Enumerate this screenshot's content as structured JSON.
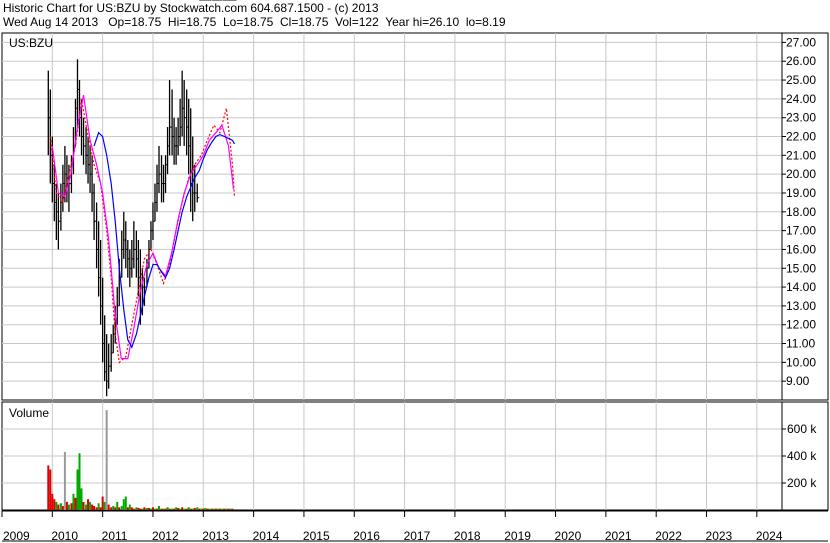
{
  "header": {
    "title": "Historic Chart for US:BZU by Stockwatch.com 604.687.1500 - (c) 2013",
    "quote": "Wed Aug 14 2013   Op=18.75  Hi=18.75  Lo=18.75  Cl=18.75  Vol=122  Year hi=26.10  lo=8.19"
  },
  "colors": {
    "grid": "#c8c8c8",
    "frame": "#000000",
    "price_bar": "#000000",
    "ma_short": "#ff0000",
    "ma_mid": "#ff00ff",
    "ma_long": "#0000ff",
    "volume_up": "#00aa00",
    "volume_down": "#dd0000",
    "volume_spike": "#999999"
  },
  "chart_data": [
    {
      "type": "line",
      "panel": "price",
      "label": "US:BZU",
      "ylim": [
        8,
        27.5
      ],
      "yticks": [
        "9.00",
        "10.00",
        "11.00",
        "12.00",
        "13.00",
        "14.00",
        "15.00",
        "16.00",
        "17.00",
        "18.00",
        "19.00",
        "20.00",
        "21.00",
        "22.00",
        "23.00",
        "24.00",
        "25.00",
        "26.00",
        "27.00"
      ],
      "xlim": [
        2009.0,
        2024.5
      ],
      "xtick_labels": [
        "2009",
        "2010",
        "2011",
        "2012",
        "2013",
        "2014",
        "2015",
        "2016",
        "2017",
        "2018",
        "2019",
        "2020",
        "2021",
        "2022",
        "2023",
        "2024"
      ],
      "grid": true,
      "series": [
        {
          "style": "price-bars",
          "x": [
            2009.92,
            2009.96,
            2010.0,
            2010.04,
            2010.08,
            2010.12,
            2010.17,
            2010.21,
            2010.25,
            2010.29,
            2010.33,
            2010.38,
            2010.42,
            2010.46,
            2010.5,
            2010.54,
            2010.58,
            2010.62,
            2010.67,
            2010.71,
            2010.75,
            2010.79,
            2010.83,
            2010.88,
            2010.92,
            2010.96,
            2011.0,
            2011.04,
            2011.08,
            2011.12,
            2011.17,
            2011.21,
            2011.25,
            2011.29,
            2011.33,
            2011.38,
            2011.42,
            2011.46,
            2011.5,
            2011.54,
            2011.58,
            2011.62,
            2011.67,
            2011.71,
            2011.75,
            2011.79,
            2011.83,
            2011.88,
            2011.92,
            2011.96,
            2012.0,
            2012.04,
            2012.08,
            2012.12,
            2012.17,
            2012.21,
            2012.25,
            2012.29,
            2012.33,
            2012.38,
            2012.42,
            2012.46,
            2012.5,
            2012.54,
            2012.58,
            2012.62,
            2012.67,
            2012.71,
            2012.75,
            2012.79,
            2012.83,
            2012.88,
            2012.92,
            2012.96,
            2013.0,
            2013.04,
            2013.08,
            2013.12,
            2013.17,
            2013.21,
            2013.25,
            2013.29,
            2013.33,
            2013.38,
            2013.42,
            2013.46,
            2013.5,
            2013.54,
            2013.58,
            2013.62
          ],
          "hi": [
            25.5,
            24.5,
            22.0,
            20.5,
            19.5,
            19.0,
            19.5,
            20.5,
            21.5,
            21.0,
            20.5,
            21.0,
            22.5,
            24.0,
            26.1,
            25.0,
            24.0,
            23.0,
            22.5,
            22.0,
            21.5,
            21.0,
            19.5,
            18.5,
            17.5,
            16.5,
            14.5,
            12.5,
            11.5,
            11.0,
            11.5,
            12.0,
            13.0,
            14.0,
            15.5,
            17.0,
            18.0,
            17.5,
            16.5,
            16.0,
            16.5,
            17.5,
            17.0,
            16.5,
            16.0,
            15.0,
            14.5,
            15.5,
            16.5,
            17.5,
            18.5,
            19.5,
            20.5,
            21.5,
            21.0,
            20.5,
            21.0,
            22.5,
            25.0,
            24.5,
            23.0,
            22.5,
            23.0,
            24.0,
            25.5,
            25.0,
            24.5,
            24.0,
            23.5,
            22.0,
            20.5,
            19.5
          ],
          "lo": [
            21.0,
            19.5,
            18.5,
            17.5,
            16.5,
            16.0,
            17.0,
            18.0,
            18.5,
            18.5,
            18.0,
            19.0,
            20.0,
            21.5,
            22.5,
            22.0,
            21.0,
            20.5,
            20.0,
            19.5,
            19.0,
            18.0,
            16.5,
            15.0,
            13.5,
            12.0,
            10.0,
            9.0,
            8.2,
            8.6,
            9.5,
            10.5,
            11.0,
            12.0,
            13.0,
            14.5,
            15.5,
            15.0,
            14.5,
            14.0,
            14.5,
            15.0,
            14.5,
            13.5,
            12.0,
            12.5,
            13.0,
            14.0,
            15.0,
            16.0,
            16.5,
            17.5,
            18.0,
            19.0,
            18.5,
            18.5,
            19.0,
            20.0,
            21.0,
            21.0,
            20.5,
            20.5,
            21.0,
            21.5,
            22.0,
            21.5,
            21.0,
            20.0,
            18.0,
            17.5,
            18.0,
            18.5
          ],
          "cl": [
            23.0,
            21.0,
            19.5,
            18.5,
            18.0,
            17.5,
            18.5,
            19.5,
            20.0,
            19.5,
            19.5,
            20.5,
            21.5,
            23.5,
            24.5,
            23.0,
            22.0,
            21.5,
            21.0,
            20.5,
            20.0,
            19.0,
            17.5,
            16.0,
            14.5,
            13.0,
            11.0,
            9.5,
            9.0,
            9.8,
            10.5,
            11.5,
            12.0,
            13.0,
            14.5,
            16.0,
            16.5,
            16.0,
            15.5,
            15.0,
            15.5,
            16.0,
            15.5,
            14.5,
            14.0,
            14.0,
            14.0,
            15.0,
            16.0,
            17.0,
            17.5,
            18.5,
            19.5,
            20.0,
            19.5,
            19.5,
            20.5,
            21.5,
            22.5,
            22.0,
            21.5,
            21.5,
            22.0,
            22.5,
            23.5,
            23.0,
            22.5,
            21.5,
            19.5,
            19.0,
            19.0,
            18.75
          ]
        },
        {
          "style": "ma",
          "color_key": "ma_short",
          "x": [
            2009.96,
            2010.08,
            2010.21,
            2010.33,
            2010.46,
            2010.58,
            2010.71,
            2010.83,
            2010.96,
            2011.08,
            2011.17,
            2011.25,
            2011.33,
            2011.46,
            2011.58,
            2011.71,
            2011.83,
            2011.96,
            2012.08,
            2012.21,
            2012.33,
            2012.46,
            2012.58,
            2012.71,
            2012.83,
            2012.96,
            2013.08,
            2013.21,
            2013.33,
            2013.46,
            2013.58,
            2013.62
          ],
          "values": [
            22.0,
            19.0,
            18.5,
            20.0,
            21.5,
            24.0,
            22.0,
            20.5,
            19.5,
            17.0,
            14.5,
            11.5,
            10.0,
            10.3,
            12.0,
            13.8,
            15.5,
            16.0,
            15.2,
            14.2,
            15.2,
            17.0,
            18.5,
            19.8,
            20.5,
            21.0,
            21.8,
            22.6,
            22.2,
            23.5,
            20.5,
            18.8
          ]
        },
        {
          "style": "ma",
          "color_key": "ma_mid",
          "x": [
            2010.0,
            2010.12,
            2010.25,
            2010.37,
            2010.5,
            2010.62,
            2010.75,
            2010.88,
            2011.0,
            2011.12,
            2011.25,
            2011.37,
            2011.5,
            2011.62,
            2011.75,
            2011.88,
            2012.0,
            2012.12,
            2012.25,
            2012.37,
            2012.5,
            2012.62,
            2012.75,
            2012.88,
            2013.0,
            2013.12,
            2013.25,
            2013.37,
            2013.5,
            2013.6
          ],
          "values": [
            21.5,
            19.0,
            18.8,
            20.0,
            22.5,
            24.2,
            21.8,
            20.5,
            19.0,
            16.5,
            12.5,
            10.2,
            10.2,
            11.8,
            13.8,
            15.2,
            15.8,
            15.0,
            14.6,
            15.8,
            17.6,
            19.0,
            20.0,
            20.5,
            21.0,
            21.8,
            22.2,
            22.6,
            21.5,
            19.2
          ]
        },
        {
          "style": "ma",
          "color_key": "ma_long",
          "x": [
            2010.83,
            2010.92,
            2011.0,
            2011.08,
            2011.17,
            2011.25,
            2011.33,
            2011.42,
            2011.5,
            2011.58,
            2011.67,
            2011.75,
            2011.83,
            2011.92,
            2012.0,
            2012.08,
            2012.17,
            2012.25,
            2012.33,
            2012.42,
            2012.5,
            2012.58,
            2012.67,
            2012.75,
            2012.83,
            2012.92,
            2013.0,
            2013.08,
            2013.17,
            2013.25,
            2013.33,
            2013.42,
            2013.5,
            2013.58,
            2013.62
          ],
          "values": [
            21.5,
            22.2,
            22.0,
            21.0,
            19.5,
            17.5,
            15.0,
            12.8,
            11.2,
            10.8,
            11.5,
            12.5,
            13.5,
            14.5,
            15.2,
            15.2,
            14.8,
            14.5,
            15.0,
            16.0,
            17.0,
            18.0,
            18.8,
            19.3,
            19.8,
            20.2,
            20.8,
            21.3,
            21.7,
            22.0,
            22.1,
            22.0,
            21.9,
            21.8,
            21.6
          ]
        }
      ]
    },
    {
      "type": "bar",
      "panel": "volume",
      "label": "Volume",
      "ylim": [
        0,
        800
      ],
      "yticks": [
        "200 k",
        "400 k",
        "600 k"
      ],
      "ytick_values": [
        200,
        400,
        600
      ],
      "x": [
        2009.92,
        2009.96,
        2010.0,
        2010.04,
        2010.08,
        2010.12,
        2010.17,
        2010.21,
        2010.25,
        2010.29,
        2010.33,
        2010.38,
        2010.42,
        2010.46,
        2010.5,
        2010.54,
        2010.58,
        2010.62,
        2010.67,
        2010.71,
        2010.75,
        2010.79,
        2010.83,
        2010.88,
        2010.92,
        2010.96,
        2011.0,
        2011.04,
        2011.08,
        2011.12,
        2011.17,
        2011.21,
        2011.25,
        2011.29,
        2011.33,
        2011.38,
        2011.42,
        2011.46,
        2011.5,
        2011.54,
        2011.58,
        2011.62,
        2011.67,
        2011.71,
        2011.75,
        2011.79,
        2011.83,
        2011.88,
        2011.92,
        2011.96,
        2012.0,
        2012.04,
        2012.08,
        2012.12,
        2012.17,
        2012.21,
        2012.25,
        2012.29,
        2012.33,
        2012.38,
        2012.42,
        2012.46,
        2012.5,
        2012.54,
        2012.58,
        2012.62,
        2012.67,
        2012.71,
        2012.75,
        2012.79,
        2012.83,
        2012.88,
        2012.92,
        2012.96,
        2013.0,
        2013.04,
        2013.08,
        2013.12,
        2013.17,
        2013.21,
        2013.25,
        2013.29,
        2013.33,
        2013.38,
        2013.42,
        2013.46,
        2013.5,
        2013.54,
        2013.58
      ],
      "values": [
        330,
        300,
        120,
        80,
        60,
        40,
        50,
        30,
        430,
        60,
        40,
        50,
        120,
        90,
        300,
        420,
        160,
        60,
        40,
        80,
        60,
        40,
        30,
        20,
        50,
        20,
        100,
        60,
        740,
        40,
        20,
        30,
        20,
        60,
        20,
        30,
        80,
        100,
        20,
        40,
        20,
        10,
        20,
        15,
        10,
        10,
        20,
        15,
        15,
        10,
        20,
        10,
        10,
        30,
        10,
        10,
        10,
        20,
        10,
        10,
        10,
        20,
        15,
        10,
        20,
        10,
        10,
        20,
        10,
        10,
        15,
        20,
        10,
        10,
        10,
        15,
        10,
        10,
        10,
        10,
        10,
        10,
        10,
        10,
        10,
        10,
        10,
        10,
        10
      ],
      "kind": [
        "d",
        "d",
        "d",
        "d",
        "u",
        "d",
        "u",
        "d",
        "s",
        "d",
        "u",
        "d",
        "u",
        "d",
        "u",
        "u",
        "u",
        "d",
        "u",
        "d",
        "u",
        "d",
        "d",
        "d",
        "u",
        "d",
        "d",
        "u",
        "s",
        "d",
        "d",
        "u",
        "d",
        "u",
        "d",
        "u",
        "u",
        "u",
        "d",
        "u",
        "d",
        "d",
        "u",
        "d",
        "d",
        "u",
        "d",
        "u",
        "d",
        "u",
        "d",
        "u",
        "d",
        "u",
        "d",
        "u",
        "d",
        "u",
        "d",
        "u",
        "d",
        "u",
        "d",
        "u",
        "d",
        "u",
        "d",
        "u",
        "d",
        "u",
        "d",
        "u",
        "d",
        "u",
        "d",
        "u",
        "d",
        "u",
        "d",
        "u",
        "d",
        "u",
        "d",
        "u",
        "d",
        "u",
        "d",
        "u",
        "d"
      ]
    }
  ]
}
